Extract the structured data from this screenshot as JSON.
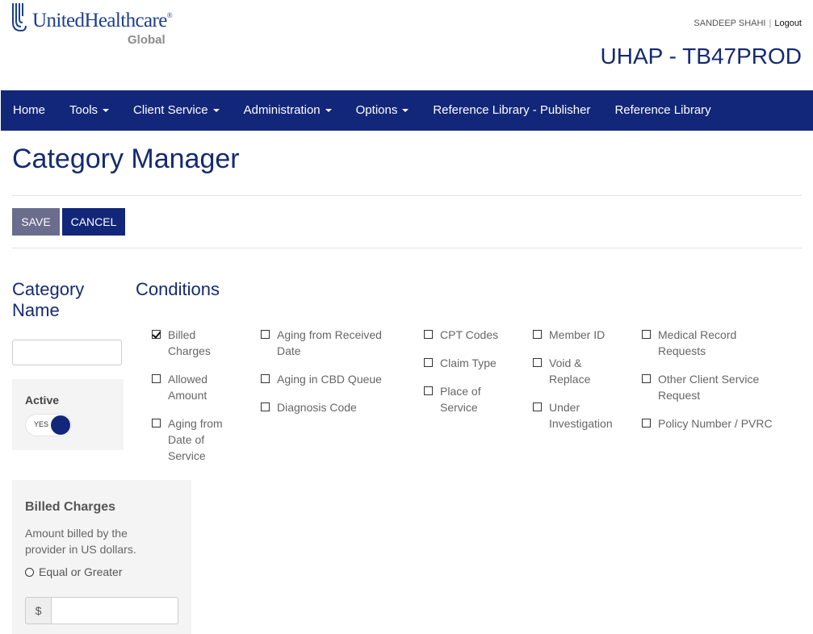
{
  "logo": {
    "brand": "UnitedHealthcare",
    "registered": "®",
    "sub": "Global"
  },
  "user": {
    "name": "SANDEEP SHAHI",
    "separator": "|",
    "logout": "Logout"
  },
  "environment": "UHAP - TB47PROD",
  "nav": [
    {
      "label": "Home",
      "dropdown": false
    },
    {
      "label": "Tools",
      "dropdown": true
    },
    {
      "label": "Client Service",
      "dropdown": true
    },
    {
      "label": "Administration",
      "dropdown": true
    },
    {
      "label": "Options",
      "dropdown": true
    },
    {
      "label": "Reference Library - Publisher",
      "dropdown": false
    },
    {
      "label": "Reference Library",
      "dropdown": false
    }
  ],
  "page_title": "Category Manager",
  "buttons": {
    "save": "SAVE",
    "cancel": "CANCEL"
  },
  "category": {
    "label_line1": "Category",
    "label_line2": "Name",
    "name_value": "",
    "active_label": "Active",
    "active_toggle": "YES"
  },
  "conditions": {
    "title": "Conditions",
    "items": [
      {
        "lines": [
          "Billed",
          "Charges"
        ],
        "checked": true
      },
      {
        "lines": [
          "Allowed",
          "Amount"
        ],
        "checked": false
      },
      {
        "lines": [
          "Aging from",
          "Date of",
          "Service"
        ],
        "checked": false
      },
      {
        "lines": [
          "Aging from Received",
          "Date"
        ],
        "checked": false
      },
      {
        "lines": [
          "Aging in CBD Queue"
        ],
        "checked": false
      },
      {
        "lines": [
          "Diagnosis Code"
        ],
        "checked": false
      },
      {
        "lines": [
          "CPT Codes"
        ],
        "checked": false
      },
      {
        "lines": [
          "Claim Type"
        ],
        "checked": false
      },
      {
        "lines": [
          "Place of",
          "Service"
        ],
        "checked": false
      },
      {
        "lines": [
          "Member ID"
        ],
        "checked": false
      },
      {
        "lines": [
          "Void &",
          "Replace"
        ],
        "checked": false
      },
      {
        "lines": [
          "Under",
          "Investigation"
        ],
        "checked": false
      },
      {
        "lines": [
          "Medical Record",
          "Requests"
        ],
        "checked": false
      },
      {
        "lines": [
          "Other Client Service",
          "Request"
        ],
        "checked": false
      },
      {
        "lines": [
          "Policy Number / PVRC"
        ],
        "checked": false
      }
    ]
  },
  "billed_charges": {
    "title": "Billed Charges",
    "description": "Amount billed by the provider in US dollars.",
    "option": "Equal or Greater",
    "currency": "$",
    "amount_value": ""
  },
  "colors": {
    "navy": "#122779",
    "title": "#152a72",
    "save_button": "#6b6d8c",
    "panel": "#f4f4f4"
  }
}
